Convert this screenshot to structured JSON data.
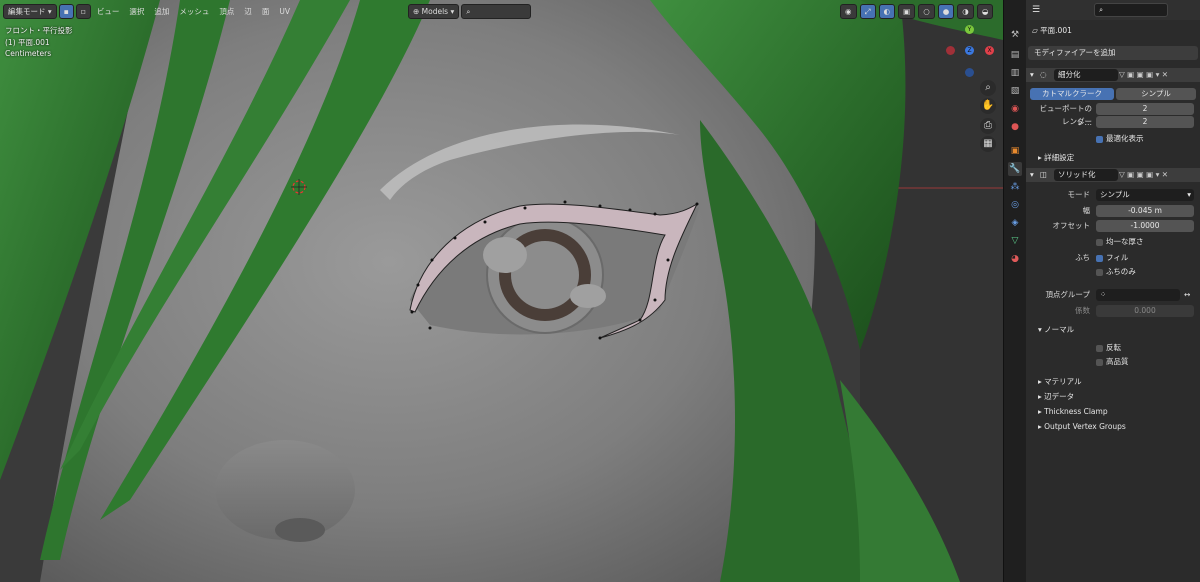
{
  "viewport": {
    "mode_label": "編集モード",
    "menus": [
      "ビュー",
      "選択",
      "追加",
      "メッシュ",
      "頂点",
      "辺",
      "面",
      "UV"
    ],
    "transform_pivot": "Models",
    "view_name": "フロント・平行投影",
    "object_name": "(1) 平面.001",
    "units": "Centimeters",
    "axis": {
      "x": "X",
      "y": "Y",
      "z": "Z"
    }
  },
  "props": {
    "object_label": "平面.001",
    "add_modifier": "モディファイアーを追加",
    "subdiv": {
      "name": "細分化",
      "tab_catmull": "カトマルクラーク",
      "tab_simple": "シンプル",
      "viewport_label": "ビューポートのレ…",
      "viewport_value": "2",
      "render_label": "レンダー",
      "render_value": "2",
      "optimal_label": "最適化表示",
      "advanced_label": "詳細設定"
    },
    "solidify": {
      "name": "ソリッド化",
      "mode_label": "モード",
      "mode_value": "シンプル",
      "width_label": "幅",
      "width_value": "-0.045 m",
      "offset_label": "オフセット",
      "offset_value": "-1.0000",
      "even_label": "均一な厚さ",
      "rim_label": "ふち",
      "fill_label": "フィル",
      "rim_only_label": "ふちのみ",
      "vgroup_label": "頂点グループ",
      "factor_label": "係数",
      "factor_value": "0.000",
      "normals_label": "ノーマル",
      "flip_label": "反転",
      "hq_label": "高品質",
      "sections": [
        "マテリアル",
        "辺データ",
        "Thickness Clamp",
        "Output Vertex Groups"
      ]
    }
  }
}
